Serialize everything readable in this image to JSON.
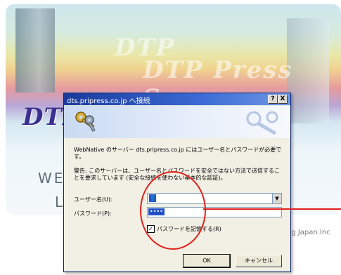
{
  "background": {
    "logo_text": "DTP",
    "ghost_line1": "DTP",
    "ghost_line2": "DTP Press Serv",
    "title_line1": "WEE",
    "title_line2": "L",
    "title_right": "",
    "footer_credit": "sing Japan.Inc"
  },
  "dialog": {
    "title": "dts.pripress.co.jp へ接続",
    "help_label": "?",
    "close_label": "X",
    "message": "WebNative のサーバー dts.pripress.co.jp にはユーザー名とパスワードが必要です。",
    "warning": "警告: このサーバーは、ユーザー名とパスワードを安全ではない方法で送信することを要求しています (安全な接続を使わない基本的な認証)。",
    "username_label": "ユーザー名(U):",
    "username_value": "",
    "password_label": "パスワード(P):",
    "password_value": "••••",
    "remember_label": "パスワードを記憶する(R)",
    "remember_checked": "✓",
    "ok_label": "OK",
    "cancel_label": "キャンセル",
    "combo_arrow": "▼"
  },
  "icons": {
    "keys": "keys-icon",
    "user": "user-icon"
  },
  "colors": {
    "titlebar": "#1a3a9c",
    "annotation": "#e0201c",
    "logo": "#3b2f8f"
  }
}
